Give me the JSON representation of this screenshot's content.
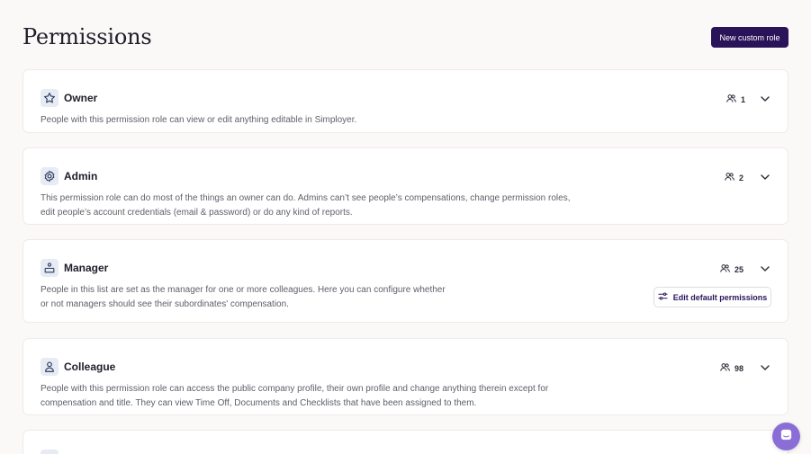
{
  "header": {
    "title": "Permissions",
    "new_role_label": "New custom role"
  },
  "roles": [
    {
      "name": "Owner",
      "icon": "star-icon",
      "count": "1",
      "description_lines": [
        "People with this permission role can view or edit anything editable in Simployer."
      ]
    },
    {
      "name": "Admin",
      "icon": "gear-icon",
      "count": "2",
      "description_lines": [
        "This permission role can do most of the things an owner can do. Admins can’t see people’s compensations, change permission roles,",
        "edit people’s account credentials (email & password) or do any kind of reports."
      ]
    },
    {
      "name": "Manager",
      "icon": "manager-icon",
      "count": "25",
      "description_lines": [
        "People in this list are set as the manager for one or more colleagues. Here you can configure whether",
        "or not managers should see their subordinates' compensation."
      ],
      "action_label": "Edit default permissions"
    },
    {
      "name": "Colleague",
      "icon": "person-icon",
      "count": "98",
      "description_lines": [
        "People with this permission role can access the public company profile, their own profile and change anything therein except for",
        "compensation and title. They can view Time Off, Documents and Checklists that have been assigned to them."
      ]
    }
  ],
  "colors": {
    "accent": "#2a1459",
    "background": "#fbf8f8",
    "icon_bg": "#e6ebf4",
    "chat": "#8b6dd8"
  }
}
